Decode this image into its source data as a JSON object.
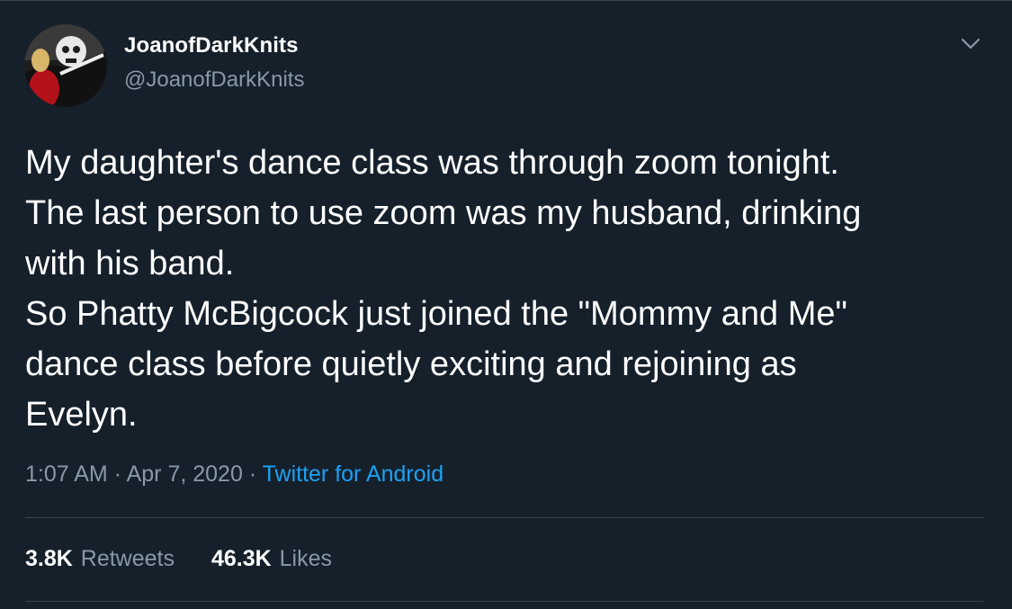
{
  "author": {
    "display_name": "JoanofDarkKnits",
    "handle": "@JoanofDarkKnits",
    "avatar_icon": "profile-photo"
  },
  "menu_icon": "chevron-down-icon",
  "tweet": {
    "lines": [
      "My daughter's dance class was through zoom tonight.",
      "The last person to use zoom was my husband, drinking",
      "with his band.",
      "So Phatty McBigcock just joined the \"Mommy and Me\"",
      "dance class before quietly exciting and rejoining as",
      "Evelyn."
    ]
  },
  "meta": {
    "time": "1:07 AM",
    "date": "Apr 7, 2020",
    "separator": "·",
    "source": "Twitter for Android"
  },
  "stats": {
    "retweets_count": "3.8K",
    "retweets_label": "Retweets",
    "likes_count": "46.3K",
    "likes_label": "Likes"
  },
  "colors": {
    "background": "#15202b",
    "text": "#ffffff",
    "secondary": "#8899a6",
    "accent": "#1da1f2",
    "border": "#38444d"
  }
}
